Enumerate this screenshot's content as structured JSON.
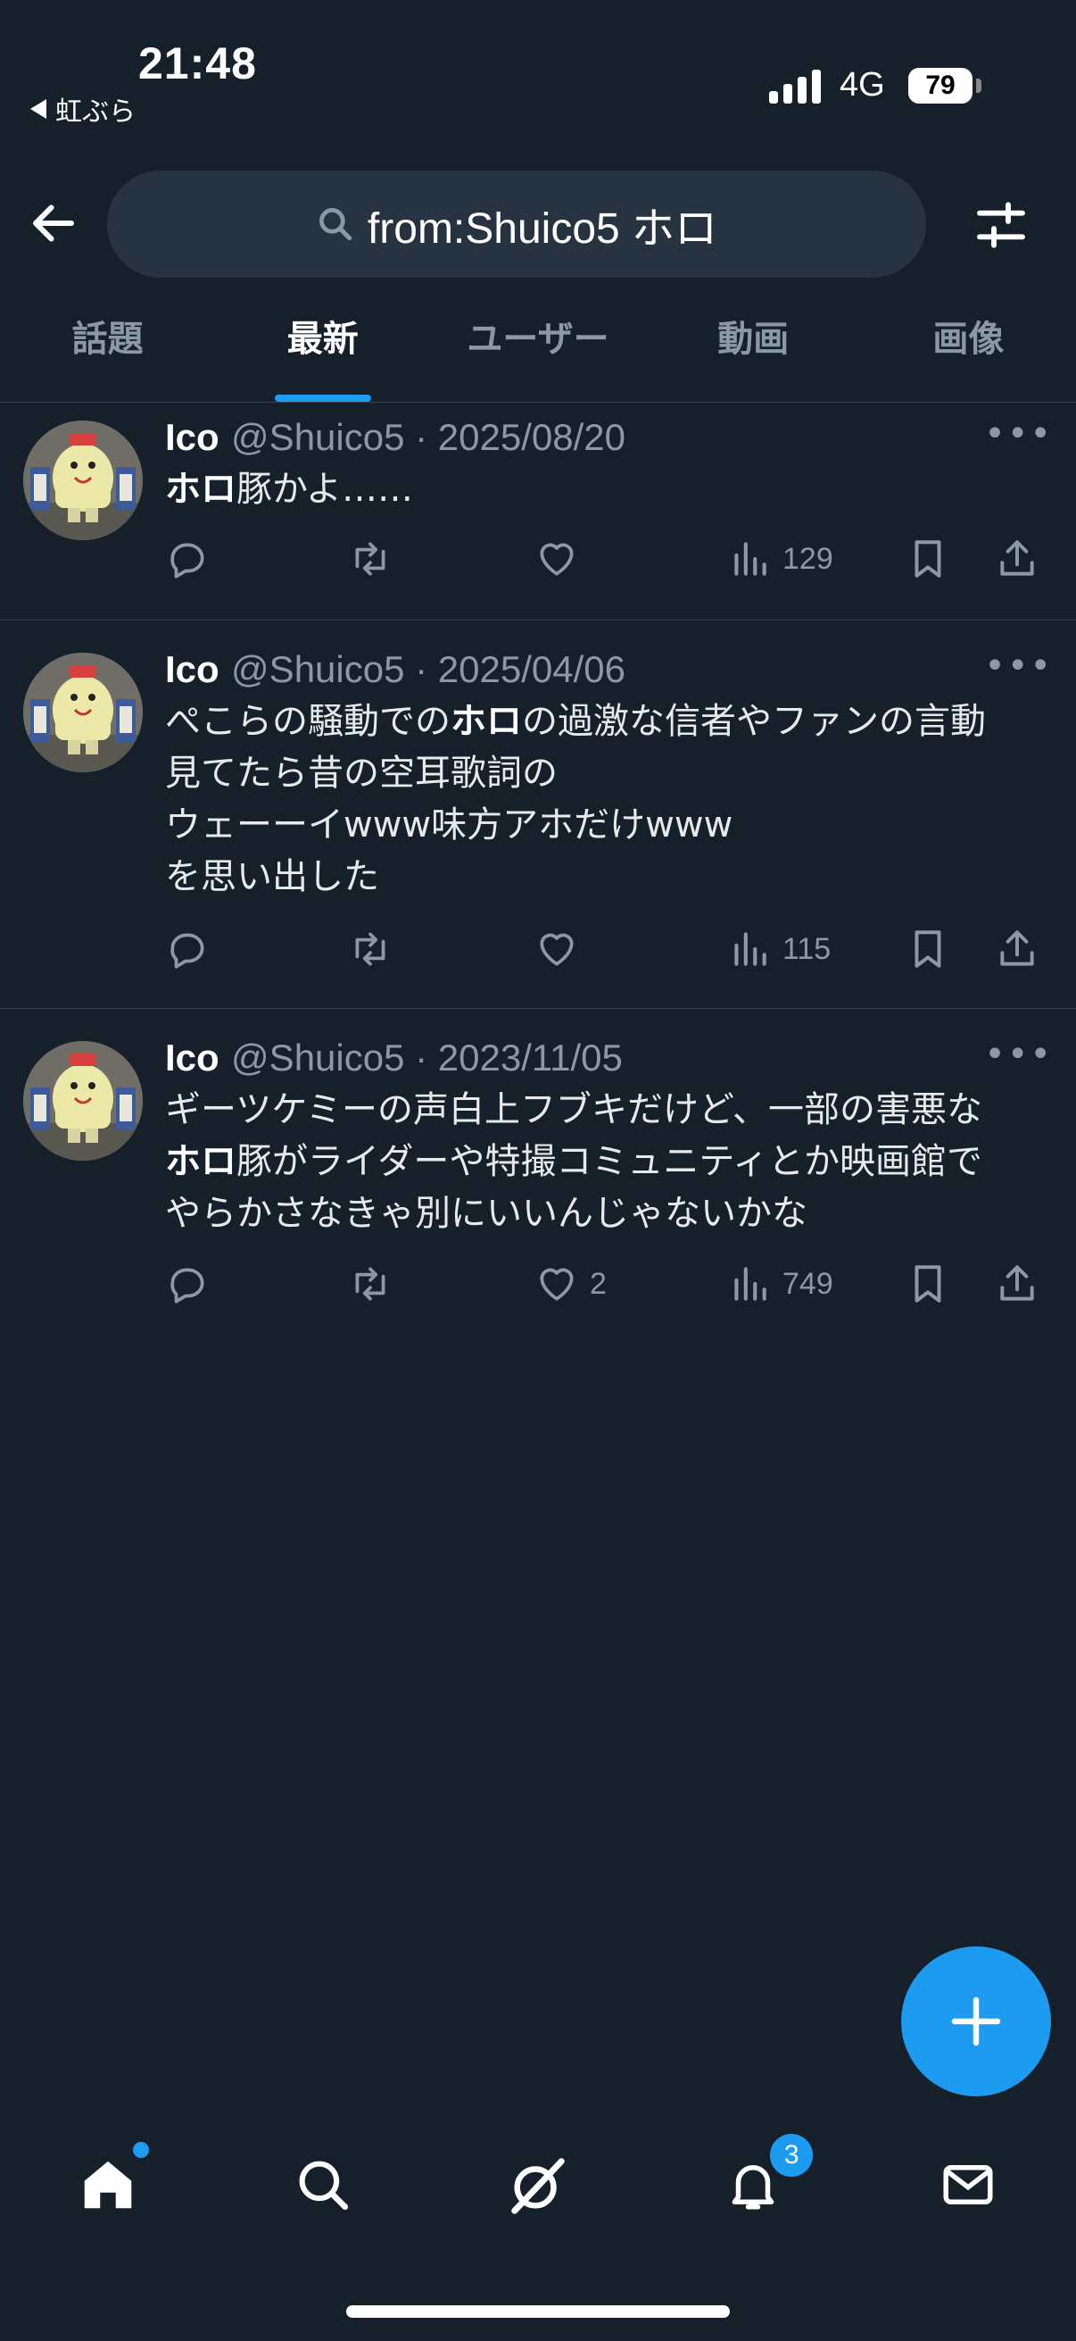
{
  "status_bar": {
    "time": "21:48",
    "back_app": "虹ぶら",
    "network": "4G",
    "battery": "79"
  },
  "search": {
    "query": "from:Shuico5 ホロ"
  },
  "tabs": [
    {
      "label": "話題",
      "active": false
    },
    {
      "label": "最新",
      "active": true
    },
    {
      "label": "ユーザー",
      "active": false
    },
    {
      "label": "動画",
      "active": false
    },
    {
      "label": "画像",
      "active": false
    }
  ],
  "tweets": [
    {
      "name": "Ico",
      "handle": "@Shuico5",
      "date": "2025/08/20",
      "text_lines": [
        [
          {
            "t": "ホロ",
            "bold": true
          },
          {
            "t": "豚かよ……",
            "bold": false
          }
        ]
      ],
      "replies": "",
      "retweets": "",
      "likes": "",
      "views": "129"
    },
    {
      "name": "Ico",
      "handle": "@Shuico5",
      "date": "2025/04/06",
      "text_lines": [
        [
          {
            "t": "ぺこらの騒動での",
            "bold": false
          },
          {
            "t": "ホロ",
            "bold": true
          },
          {
            "t": "の過激な信者やファンの言動",
            "bold": false
          }
        ],
        [
          {
            "t": "見てたら昔の空耳歌詞の",
            "bold": false
          }
        ],
        [
          {
            "t": "ウェーーイwww味方アホだけwww",
            "bold": false
          }
        ],
        [
          {
            "t": "を思い出した",
            "bold": false
          }
        ]
      ],
      "replies": "",
      "retweets": "",
      "likes": "",
      "views": "115"
    },
    {
      "name": "Ico",
      "handle": "@Shuico5",
      "date": "2023/11/05",
      "text_lines": [
        [
          {
            "t": "ギーツケミーの声白上フブキだけど、一部の害悪な",
            "bold": false
          }
        ],
        [
          {
            "t": "ホロ",
            "bold": true
          },
          {
            "t": "豚がライダーや特撮コミュニティとか映画館で",
            "bold": false
          }
        ],
        [
          {
            "t": "やらかさなきゃ別にいいんじゃないかな",
            "bold": false
          }
        ]
      ],
      "replies": "",
      "retweets": "",
      "likes": "2",
      "views": "749"
    }
  ],
  "bottom_nav": [
    {
      "name": "home-icon",
      "badge": ""
    },
    {
      "name": "search-icon",
      "badge": ""
    },
    {
      "name": "grok-icon",
      "badge": ""
    },
    {
      "name": "notifications-icon",
      "badge": "3"
    },
    {
      "name": "messages-icon",
      "badge": ""
    }
  ],
  "colors": {
    "background": "#15202b",
    "accent": "#1d9bf0",
    "muted": "#8b98a5",
    "divider": "#38444d"
  }
}
